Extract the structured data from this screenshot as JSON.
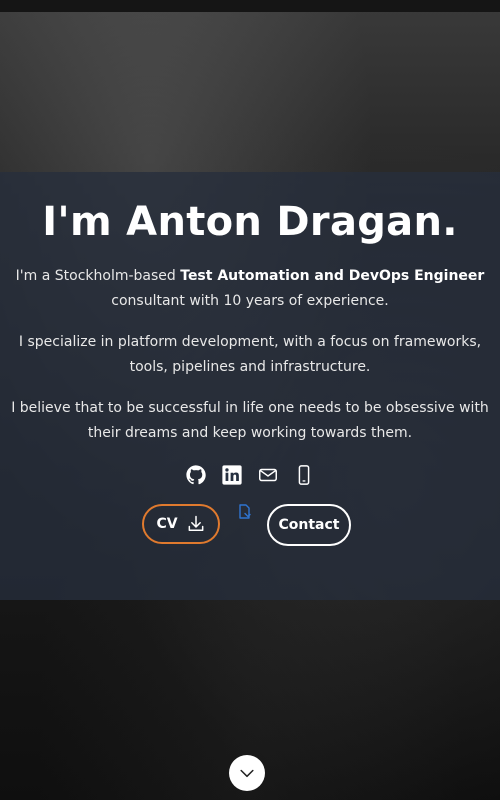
{
  "hero": {
    "title": "I'm Anton Dragan.",
    "intro_prefix": "I'm a Stockholm-based ",
    "intro_role": "Test Automation and DevOps Engineer",
    "intro_suffix": " consultant with 10 years of experience.",
    "paragraph_2": "I specialize in platform development, with a focus on frameworks, tools, pipelines and infrastructure.",
    "paragraph_3": "I believe that to be successful in life one needs to be obsessive with their dreams and keep working towards them."
  },
  "social": [
    {
      "icon": "github-icon"
    },
    {
      "icon": "linkedin-icon"
    },
    {
      "icon": "mail-icon"
    },
    {
      "icon": "phone-icon"
    }
  ],
  "buttons": {
    "cv_label": "CV",
    "cv_icon": "download-icon",
    "doc_icon": "document-icon",
    "contact_label": "Contact"
  },
  "scroll": {
    "icon": "chevron-down-icon"
  },
  "colors": {
    "cv_border": "#e07a2e",
    "doc_icon": "#2f74d0",
    "panel_bg": "#262e3c"
  }
}
